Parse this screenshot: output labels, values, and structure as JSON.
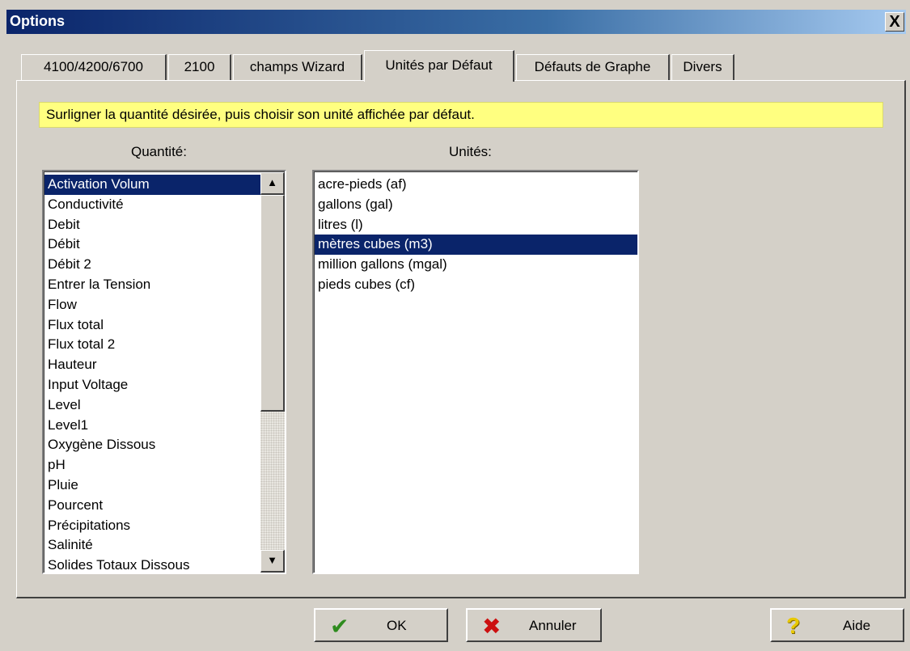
{
  "window": {
    "title": "Options",
    "close_label": "X"
  },
  "tabs": [
    {
      "label": "4100/4200/6700",
      "active": false
    },
    {
      "label": "2100",
      "active": false
    },
    {
      "label": "champs Wizard",
      "active": false
    },
    {
      "label": "Unités par Défaut",
      "active": true
    },
    {
      "label": "Défauts de Graphe",
      "active": false
    },
    {
      "label": "Divers",
      "active": false
    }
  ],
  "hint": "Surligner la quantité désirée, puis choisir son unité affichée par défaut.",
  "quantities": {
    "label": "Quantité:",
    "selected": "Activation Volum",
    "items": [
      "Activation Volum",
      "Conductivité",
      "Debit",
      "Débit",
      "Débit 2",
      "Entrer la Tension",
      "Flow",
      "Flux total",
      "Flux total 2",
      "Hauteur",
      "Input Voltage",
      "Level",
      "Level1",
      "Oxygène Dissous",
      "pH",
      "Pluie",
      "Pourcent",
      "Précipitations",
      "Salinité",
      "Solides Totaux Dissous"
    ]
  },
  "units": {
    "label": "Unités:",
    "selected": "mètres cubes (m3)",
    "items": [
      "acre-pieds (af)",
      "gallons (gal)",
      "litres (l)",
      "mètres cubes (m3)",
      "million gallons (mgal)",
      "pieds cubes (cf)"
    ]
  },
  "buttons": {
    "ok": {
      "label": "OK",
      "icon": "checkmark-icon",
      "color": "#2e8b1e"
    },
    "cancel": {
      "label": "Annuler",
      "icon": "x-icon",
      "color": "#cc1010"
    },
    "help": {
      "label": "Aide",
      "icon": "question-icon",
      "color": "#e8c800"
    }
  },
  "colors": {
    "title_bar": "#0a246a",
    "selection": "#0a246a",
    "hint_background": "#ffff80",
    "dialog_face": "#d4d0c8"
  }
}
